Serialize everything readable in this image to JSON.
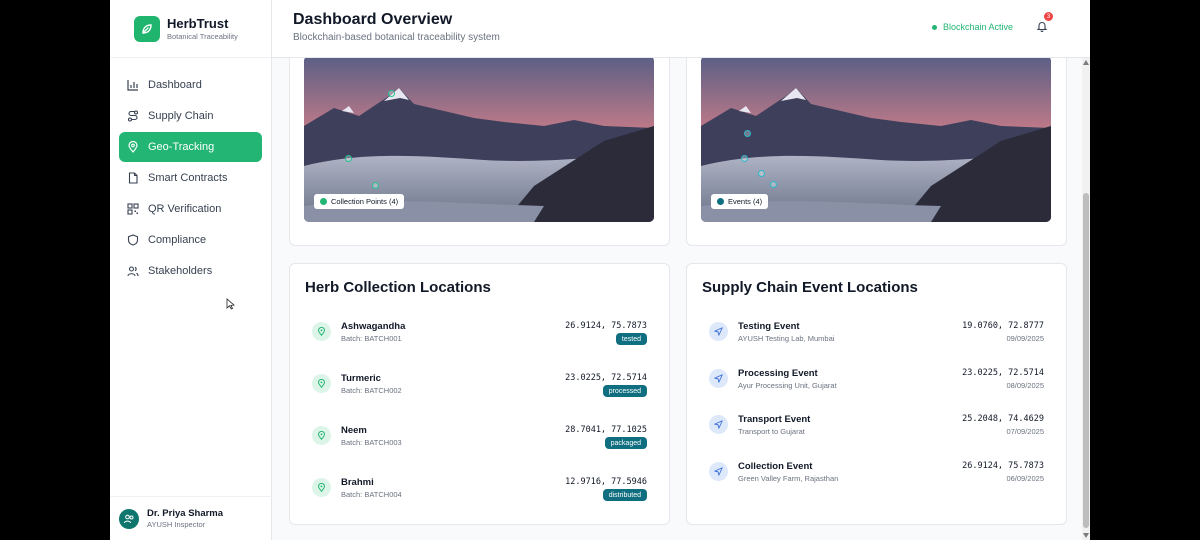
{
  "brand": {
    "name": "HerbTrust",
    "subtitle": "Botanical Traceability"
  },
  "nav": [
    {
      "label": "Dashboard",
      "icon": "bar-chart-icon",
      "active": false
    },
    {
      "label": "Supply Chain",
      "icon": "route-icon",
      "active": false
    },
    {
      "label": "Geo-Tracking",
      "icon": "map-pin-icon",
      "active": true
    },
    {
      "label": "Smart Contracts",
      "icon": "document-icon",
      "active": false
    },
    {
      "label": "QR Verification",
      "icon": "qr-code-icon",
      "active": false
    },
    {
      "label": "Compliance",
      "icon": "shield-icon",
      "active": false
    },
    {
      "label": "Stakeholders",
      "icon": "users-icon",
      "active": false
    }
  ],
  "user": {
    "name": "Dr. Priya Sharma",
    "role": "AYUSH Inspector"
  },
  "header": {
    "title": "Dashboard Overview",
    "subtitle": "Blockchain-based botanical traceability system",
    "status": "Blockchain Active",
    "notification_count": "3"
  },
  "maps": [
    {
      "legend": "Collection Points (4)",
      "dot_color": "#22b573"
    },
    {
      "legend": "Events (4)",
      "dot_color": "#0f6e7f"
    }
  ],
  "collections": {
    "title": "Herb Collection Locations",
    "items": [
      {
        "name": "Ashwagandha",
        "batch": "Batch: BATCH001",
        "coords": "26.9124, 75.7873",
        "status": "tested"
      },
      {
        "name": "Turmeric",
        "batch": "Batch: BATCH002",
        "coords": "23.0225, 72.5714",
        "status": "processed"
      },
      {
        "name": "Neem",
        "batch": "Batch: BATCH003",
        "coords": "28.7041, 77.1025",
        "status": "packaged"
      },
      {
        "name": "Brahmi",
        "batch": "Batch: BATCH004",
        "coords": "12.9716, 77.5946",
        "status": "distributed"
      }
    ]
  },
  "events": {
    "title": "Supply Chain Event Locations",
    "items": [
      {
        "name": "Testing Event",
        "place": "AYUSH Testing Lab, Mumbai",
        "coords": "19.0760, 72.8777",
        "date": "09/09/2025"
      },
      {
        "name": "Processing Event",
        "place": "Ayur Processing Unit, Gujarat",
        "coords": "23.0225, 72.5714",
        "date": "08/09/2025"
      },
      {
        "name": "Transport Event",
        "place": "Transport to Gujarat",
        "coords": "25.2048, 74.4629",
        "date": "07/09/2025"
      },
      {
        "name": "Collection Event",
        "place": "Green Valley Farm, Rajasthan",
        "coords": "26.9124, 75.7873",
        "date": "06/09/2025"
      }
    ]
  }
}
